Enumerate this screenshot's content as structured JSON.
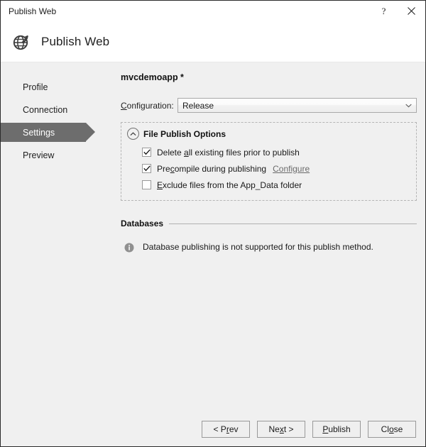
{
  "window": {
    "title": "Publish Web",
    "help_label": "?",
    "close_label": "✕"
  },
  "header": {
    "title": "Publish Web",
    "icon": "globe-publish-icon"
  },
  "sidebar": {
    "items": [
      {
        "label": "Profile",
        "selected": false
      },
      {
        "label": "Connection",
        "selected": false
      },
      {
        "label": "Settings",
        "selected": true
      },
      {
        "label": "Preview",
        "selected": false
      }
    ]
  },
  "main": {
    "profile_name": "mvcdemoapp *",
    "configuration": {
      "label_pre": "",
      "label_accel": "C",
      "label_post": "onfiguration:",
      "value": "Release",
      "arrow_icon": "chevron-down-icon"
    },
    "file_publish_options": {
      "title": "File Publish Options",
      "collapse_icon": "chevron-up-icon",
      "options": [
        {
          "pre": "Delete ",
          "accel": "a",
          "post": "ll existing files prior to publish",
          "checked": true,
          "link": ""
        },
        {
          "pre": "Pre",
          "accel": "c",
          "post": "ompile during publishing",
          "checked": true,
          "link": "Configure"
        },
        {
          "pre": "",
          "accel": "E",
          "post": "xclude files from the App_Data folder",
          "checked": false,
          "link": ""
        }
      ]
    },
    "databases": {
      "title": "Databases",
      "info_icon": "info-icon",
      "message": "Database publishing is not supported for this publish method."
    }
  },
  "footer": {
    "buttons": [
      {
        "pre": "< P",
        "accel": "r",
        "post": "ev"
      },
      {
        "pre": "Ne",
        "accel": "x",
        "post": "t >"
      },
      {
        "pre": "",
        "accel": "P",
        "post": "ublish"
      },
      {
        "pre": "Cl",
        "accel": "o",
        "post": "se"
      }
    ]
  },
  "colors": {
    "dialog_bg": "#f0f0f0",
    "header_bg": "#ffffff",
    "selected_item": "#6d6d6d",
    "border": "#2b2b2b"
  }
}
